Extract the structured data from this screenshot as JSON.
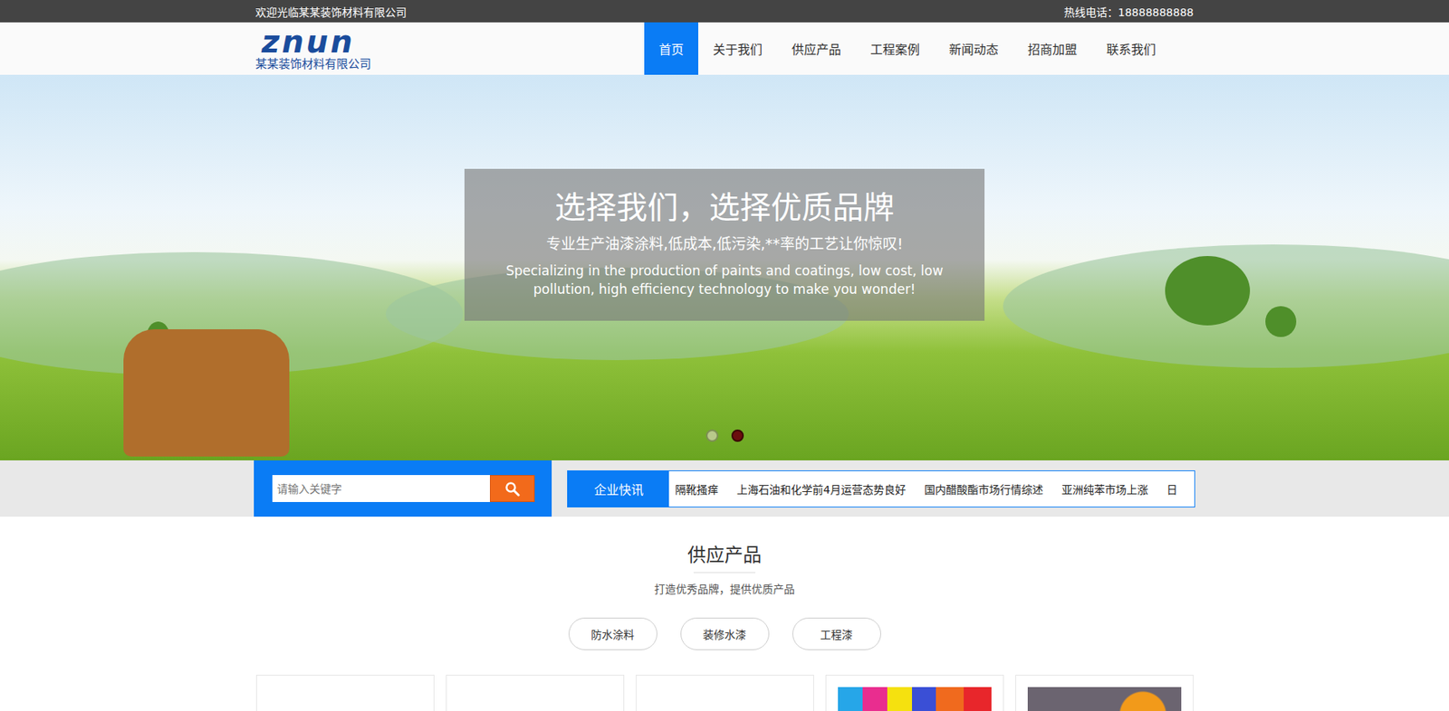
{
  "topbar": {
    "welcome": "欢迎光临某某装饰材料有限公司",
    "hotline": "热线电话：18888888888"
  },
  "logo": {
    "mark": "znun",
    "name": "某某装饰材料有限公司"
  },
  "nav": [
    {
      "label": "首页",
      "selected": true
    },
    {
      "label": "关于我们",
      "selected": false
    },
    {
      "label": "供应产品",
      "selected": false
    },
    {
      "label": "工程案例",
      "selected": false
    },
    {
      "label": "新闻动态",
      "selected": false
    },
    {
      "label": "招商加盟",
      "selected": false
    },
    {
      "label": "联系我们",
      "selected": false
    }
  ],
  "banner": {
    "title": "选择我们，选择优质品牌",
    "subtitle": "专业生产油漆涂料,低成本,低污染,**率的工艺让你惊叹!",
    "english": "Specializing in the production of paints and coatings, low cost, low pollution, high efficiency technology to make you wonder!",
    "dots": [
      {
        "selected": false
      },
      {
        "selected": true
      }
    ]
  },
  "search": {
    "placeholder": "请输入关键字"
  },
  "news": {
    "label": "企业快讯",
    "items": [
      "隔靴搔痒",
      "上海石油和化学前4月运营态势良好",
      "国内醋酸酯市场行情综述",
      "亚洲纯苯市场上涨",
      "日"
    ]
  },
  "products": {
    "title": "供应产品",
    "subtitle": "打造优秀品牌，提供优质产品",
    "tabs": [
      {
        "label": "防水涂料",
        "selected": false
      },
      {
        "label": "装修水漆",
        "selected": false
      },
      {
        "label": "工程漆",
        "selected": false
      }
    ]
  }
}
